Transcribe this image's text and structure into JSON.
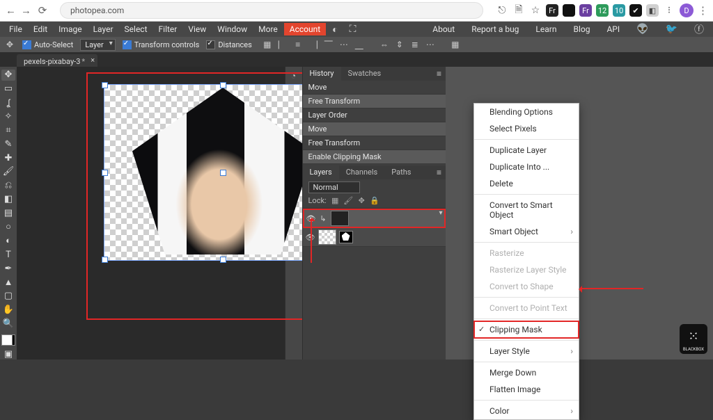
{
  "browser": {
    "url": "photopea.com",
    "avatar_initial": "D",
    "ext_labels": [
      "Fr",
      "",
      "Fr",
      "12",
      "10",
      "",
      "",
      ""
    ]
  },
  "menubar": {
    "items": [
      "File",
      "Edit",
      "Image",
      "Layer",
      "Select",
      "Filter",
      "View",
      "Window",
      "More"
    ],
    "account": "Account",
    "right": [
      "About",
      "Report a bug",
      "Learn",
      "Blog",
      "API"
    ]
  },
  "optbar": {
    "auto_select": "Auto-Select",
    "layer_mode": "Layer",
    "transform_controls": "Transform controls",
    "distances": "Distances"
  },
  "doc_tab": {
    "label": "pexels-pixabay-3",
    "dirty": "*"
  },
  "panels": {
    "history_tab": "History",
    "swatches_tab": "Swatches",
    "history_items": [
      "Move",
      "Free Transform",
      "Layer Order",
      "Move",
      "Free Transform",
      "Enable Clipping Mask"
    ],
    "layers_tab": "Layers",
    "channels_tab": "Channels",
    "paths_tab": "Paths",
    "blend_mode": "Normal",
    "lock_label": "Lock:"
  },
  "ctx": {
    "blending_options": "Blending Options",
    "select_pixels": "Select Pixels",
    "duplicate_layer": "Duplicate Layer",
    "duplicate_into": "Duplicate Into ...",
    "delete": "Delete",
    "convert_smart": "Convert to Smart Object",
    "smart_object": "Smart Object",
    "rasterize": "Rasterize",
    "rasterize_style": "Rasterize Layer Style",
    "convert_shape": "Convert to Shape",
    "convert_point_text": "Convert to Point Text",
    "clipping_mask": "Clipping Mask",
    "layer_style": "Layer Style",
    "merge_down": "Merge Down",
    "flatten": "Flatten Image",
    "color": "Color"
  },
  "brand": "BLACKBOX"
}
